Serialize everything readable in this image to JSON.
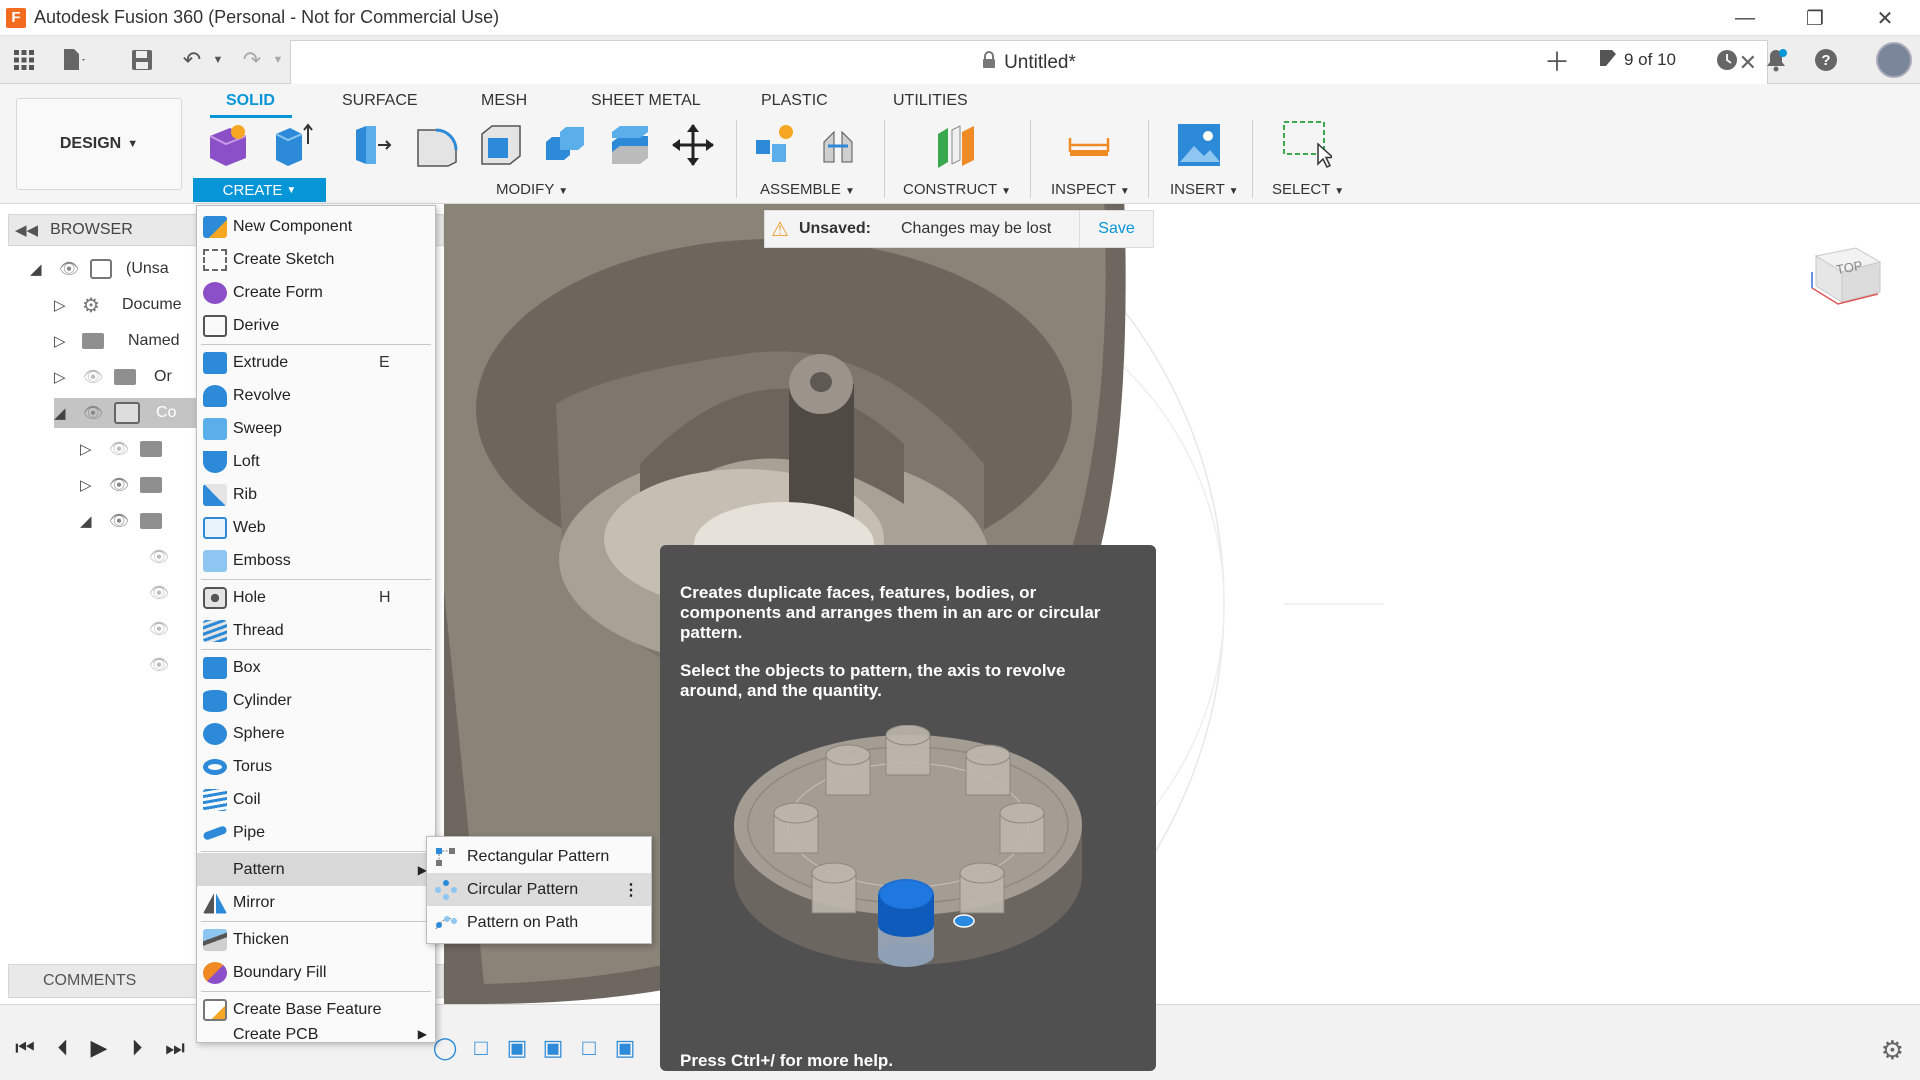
{
  "window": {
    "title": "Autodesk Fusion 360 (Personal - Not for Commercial Use)",
    "logo_letter": "F"
  },
  "quick_access": {
    "doc_title": "Untitled*",
    "count": "9 of 10"
  },
  "toolbar": {
    "workspace": "DESIGN",
    "tabs": [
      "SOLID",
      "SURFACE",
      "MESH",
      "SHEET METAL",
      "PLASTIC",
      "UTILITIES"
    ],
    "groups": [
      "CREATE",
      "MODIFY",
      "ASSEMBLE",
      "CONSTRUCT",
      "INSPECT",
      "INSERT",
      "SELECT"
    ]
  },
  "browser": {
    "header": "BROWSER",
    "rows": [
      "(Unsa",
      "Docume",
      "Named",
      "Or",
      "Co"
    ],
    "comments": "COMMENTS"
  },
  "unsaved": {
    "label": "Unsaved:",
    "message": "Changes may be lost",
    "save": "Save"
  },
  "viewcube": {
    "face": "TOP"
  },
  "create_menu": {
    "items": [
      {
        "label": "New Component"
      },
      {
        "label": "Create Sketch"
      },
      {
        "label": "Create Form"
      },
      {
        "label": "Derive"
      },
      {
        "label": "Extrude",
        "shortcut": "E"
      },
      {
        "label": "Revolve"
      },
      {
        "label": "Sweep"
      },
      {
        "label": "Loft"
      },
      {
        "label": "Rib"
      },
      {
        "label": "Web"
      },
      {
        "label": "Emboss"
      },
      {
        "label": "Hole",
        "shortcut": "H"
      },
      {
        "label": "Thread"
      },
      {
        "label": "Box"
      },
      {
        "label": "Cylinder"
      },
      {
        "label": "Sphere"
      },
      {
        "label": "Torus"
      },
      {
        "label": "Coil"
      },
      {
        "label": "Pipe"
      },
      {
        "label": "Pattern"
      },
      {
        "label": "Mirror"
      },
      {
        "label": "Thicken"
      },
      {
        "label": "Boundary Fill"
      },
      {
        "label": "Create Base Feature"
      },
      {
        "label": "Create PCB"
      }
    ]
  },
  "pattern_submenu": {
    "items": [
      "Rectangular Pattern",
      "Circular Pattern",
      "Pattern on Path"
    ]
  },
  "tooltip": {
    "para1": "Creates duplicate faces, features, bodies, or components and arranges them in an arc or circular pattern.",
    "para2": "Select the objects to pattern, the axis to revolve around, and the quantity.",
    "footer": "Press Ctrl+/ for more help."
  },
  "colors": {
    "accent": "#0696d7",
    "tooltip_bg": "#505050",
    "model": "#8a8378"
  }
}
